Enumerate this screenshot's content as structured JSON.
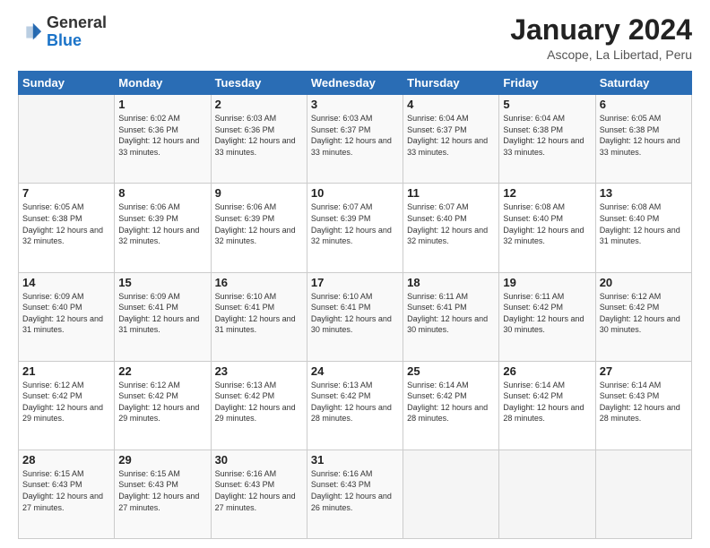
{
  "logo": {
    "line1": "General",
    "line2": "Blue"
  },
  "title": "January 2024",
  "subtitle": "Ascope, La Libertad, Peru",
  "weekdays": [
    "Sunday",
    "Monday",
    "Tuesday",
    "Wednesday",
    "Thursday",
    "Friday",
    "Saturday"
  ],
  "weeks": [
    [
      {
        "day": "",
        "sunrise": "",
        "sunset": "",
        "daylight": ""
      },
      {
        "day": "1",
        "sunrise": "Sunrise: 6:02 AM",
        "sunset": "Sunset: 6:36 PM",
        "daylight": "Daylight: 12 hours and 33 minutes."
      },
      {
        "day": "2",
        "sunrise": "Sunrise: 6:03 AM",
        "sunset": "Sunset: 6:36 PM",
        "daylight": "Daylight: 12 hours and 33 minutes."
      },
      {
        "day": "3",
        "sunrise": "Sunrise: 6:03 AM",
        "sunset": "Sunset: 6:37 PM",
        "daylight": "Daylight: 12 hours and 33 minutes."
      },
      {
        "day": "4",
        "sunrise": "Sunrise: 6:04 AM",
        "sunset": "Sunset: 6:37 PM",
        "daylight": "Daylight: 12 hours and 33 minutes."
      },
      {
        "day": "5",
        "sunrise": "Sunrise: 6:04 AM",
        "sunset": "Sunset: 6:38 PM",
        "daylight": "Daylight: 12 hours and 33 minutes."
      },
      {
        "day": "6",
        "sunrise": "Sunrise: 6:05 AM",
        "sunset": "Sunset: 6:38 PM",
        "daylight": "Daylight: 12 hours and 33 minutes."
      }
    ],
    [
      {
        "day": "7",
        "sunrise": "Sunrise: 6:05 AM",
        "sunset": "Sunset: 6:38 PM",
        "daylight": "Daylight: 12 hours and 32 minutes."
      },
      {
        "day": "8",
        "sunrise": "Sunrise: 6:06 AM",
        "sunset": "Sunset: 6:39 PM",
        "daylight": "Daylight: 12 hours and 32 minutes."
      },
      {
        "day": "9",
        "sunrise": "Sunrise: 6:06 AM",
        "sunset": "Sunset: 6:39 PM",
        "daylight": "Daylight: 12 hours and 32 minutes."
      },
      {
        "day": "10",
        "sunrise": "Sunrise: 6:07 AM",
        "sunset": "Sunset: 6:39 PM",
        "daylight": "Daylight: 12 hours and 32 minutes."
      },
      {
        "day": "11",
        "sunrise": "Sunrise: 6:07 AM",
        "sunset": "Sunset: 6:40 PM",
        "daylight": "Daylight: 12 hours and 32 minutes."
      },
      {
        "day": "12",
        "sunrise": "Sunrise: 6:08 AM",
        "sunset": "Sunset: 6:40 PM",
        "daylight": "Daylight: 12 hours and 32 minutes."
      },
      {
        "day": "13",
        "sunrise": "Sunrise: 6:08 AM",
        "sunset": "Sunset: 6:40 PM",
        "daylight": "Daylight: 12 hours and 31 minutes."
      }
    ],
    [
      {
        "day": "14",
        "sunrise": "Sunrise: 6:09 AM",
        "sunset": "Sunset: 6:40 PM",
        "daylight": "Daylight: 12 hours and 31 minutes."
      },
      {
        "day": "15",
        "sunrise": "Sunrise: 6:09 AM",
        "sunset": "Sunset: 6:41 PM",
        "daylight": "Daylight: 12 hours and 31 minutes."
      },
      {
        "day": "16",
        "sunrise": "Sunrise: 6:10 AM",
        "sunset": "Sunset: 6:41 PM",
        "daylight": "Daylight: 12 hours and 31 minutes."
      },
      {
        "day": "17",
        "sunrise": "Sunrise: 6:10 AM",
        "sunset": "Sunset: 6:41 PM",
        "daylight": "Daylight: 12 hours and 30 minutes."
      },
      {
        "day": "18",
        "sunrise": "Sunrise: 6:11 AM",
        "sunset": "Sunset: 6:41 PM",
        "daylight": "Daylight: 12 hours and 30 minutes."
      },
      {
        "day": "19",
        "sunrise": "Sunrise: 6:11 AM",
        "sunset": "Sunset: 6:42 PM",
        "daylight": "Daylight: 12 hours and 30 minutes."
      },
      {
        "day": "20",
        "sunrise": "Sunrise: 6:12 AM",
        "sunset": "Sunset: 6:42 PM",
        "daylight": "Daylight: 12 hours and 30 minutes."
      }
    ],
    [
      {
        "day": "21",
        "sunrise": "Sunrise: 6:12 AM",
        "sunset": "Sunset: 6:42 PM",
        "daylight": "Daylight: 12 hours and 29 minutes."
      },
      {
        "day": "22",
        "sunrise": "Sunrise: 6:12 AM",
        "sunset": "Sunset: 6:42 PM",
        "daylight": "Daylight: 12 hours and 29 minutes."
      },
      {
        "day": "23",
        "sunrise": "Sunrise: 6:13 AM",
        "sunset": "Sunset: 6:42 PM",
        "daylight": "Daylight: 12 hours and 29 minutes."
      },
      {
        "day": "24",
        "sunrise": "Sunrise: 6:13 AM",
        "sunset": "Sunset: 6:42 PM",
        "daylight": "Daylight: 12 hours and 28 minutes."
      },
      {
        "day": "25",
        "sunrise": "Sunrise: 6:14 AM",
        "sunset": "Sunset: 6:42 PM",
        "daylight": "Daylight: 12 hours and 28 minutes."
      },
      {
        "day": "26",
        "sunrise": "Sunrise: 6:14 AM",
        "sunset": "Sunset: 6:42 PM",
        "daylight": "Daylight: 12 hours and 28 minutes."
      },
      {
        "day": "27",
        "sunrise": "Sunrise: 6:14 AM",
        "sunset": "Sunset: 6:43 PM",
        "daylight": "Daylight: 12 hours and 28 minutes."
      }
    ],
    [
      {
        "day": "28",
        "sunrise": "Sunrise: 6:15 AM",
        "sunset": "Sunset: 6:43 PM",
        "daylight": "Daylight: 12 hours and 27 minutes."
      },
      {
        "day": "29",
        "sunrise": "Sunrise: 6:15 AM",
        "sunset": "Sunset: 6:43 PM",
        "daylight": "Daylight: 12 hours and 27 minutes."
      },
      {
        "day": "30",
        "sunrise": "Sunrise: 6:16 AM",
        "sunset": "Sunset: 6:43 PM",
        "daylight": "Daylight: 12 hours and 27 minutes."
      },
      {
        "day": "31",
        "sunrise": "Sunrise: 6:16 AM",
        "sunset": "Sunset: 6:43 PM",
        "daylight": "Daylight: 12 hours and 26 minutes."
      },
      {
        "day": "",
        "sunrise": "",
        "sunset": "",
        "daylight": ""
      },
      {
        "day": "",
        "sunrise": "",
        "sunset": "",
        "daylight": ""
      },
      {
        "day": "",
        "sunrise": "",
        "sunset": "",
        "daylight": ""
      }
    ]
  ]
}
